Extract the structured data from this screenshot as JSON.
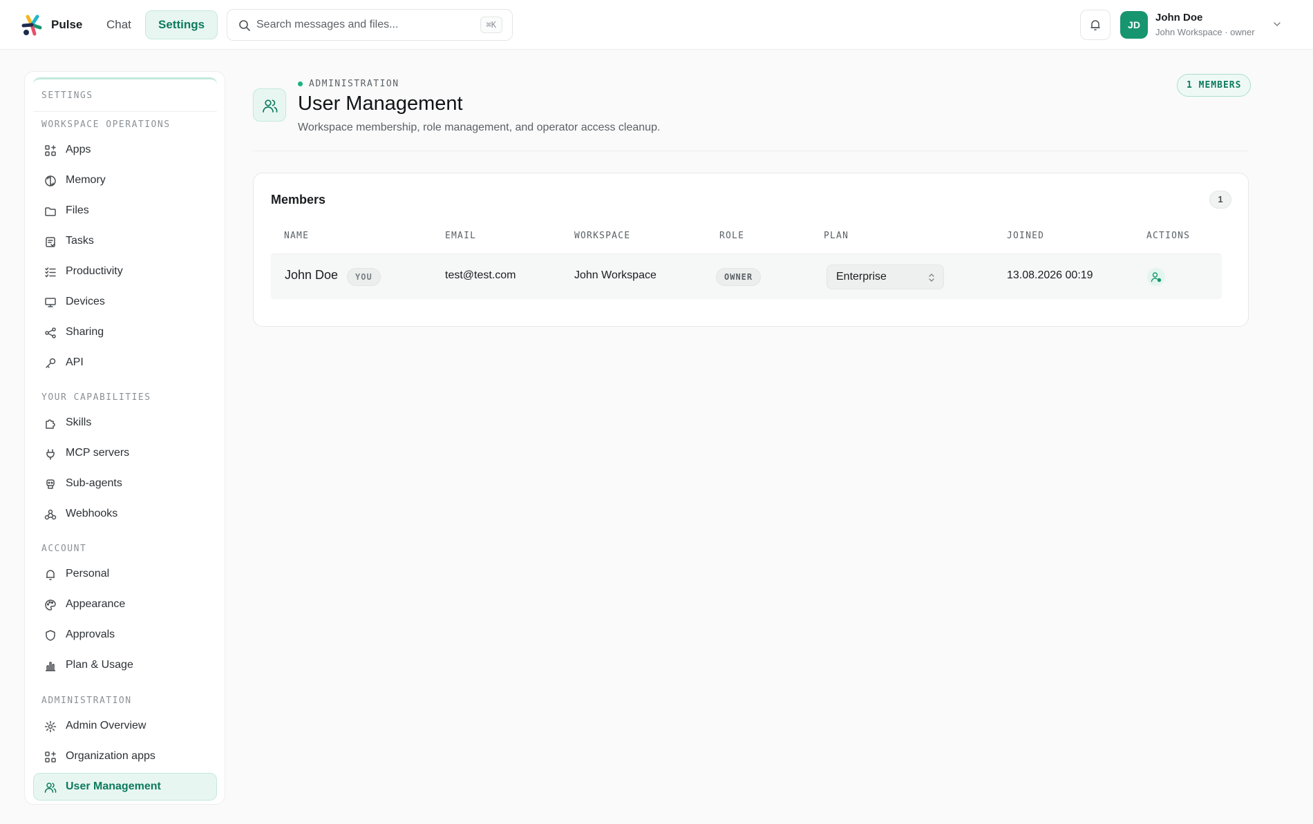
{
  "app": {
    "name": "Pulse"
  },
  "nav": {
    "tabs": [
      "Chat",
      "Settings"
    ],
    "active": "Settings"
  },
  "search": {
    "placeholder": "Search messages and files...",
    "value": "",
    "shortcut": "⌘K"
  },
  "user": {
    "initials": "JD",
    "name": "John Doe",
    "subtitle": "John Workspace · owner"
  },
  "colors": {
    "accent": "#17956f",
    "accent_soft": "#e8f6f1",
    "accent_text": "#0c7a5d"
  },
  "sidebar": {
    "title": "SETTINGS",
    "sections": [
      {
        "heading": "WORKSPACE OPERATIONS",
        "items": [
          {
            "label": "Apps",
            "icon": "grid-plus-icon"
          },
          {
            "label": "Memory",
            "icon": "brain-icon"
          },
          {
            "label": "Files",
            "icon": "folder-icon"
          },
          {
            "label": "Tasks",
            "icon": "clipboard-icon"
          },
          {
            "label": "Productivity",
            "icon": "list-checks-icon"
          },
          {
            "label": "Devices",
            "icon": "monitor-icon"
          },
          {
            "label": "Sharing",
            "icon": "share-icon"
          },
          {
            "label": "API",
            "icon": "key-icon"
          }
        ]
      },
      {
        "heading": "YOUR CAPABILITIES",
        "items": [
          {
            "label": "Skills",
            "icon": "puzzle-icon"
          },
          {
            "label": "MCP servers",
            "icon": "plug-icon"
          },
          {
            "label": "Sub-agents",
            "icon": "bot-icon"
          },
          {
            "label": "Webhooks",
            "icon": "webhook-icon"
          }
        ]
      },
      {
        "heading": "ACCOUNT",
        "items": [
          {
            "label": "Personal",
            "icon": "bell-icon"
          },
          {
            "label": "Appearance",
            "icon": "palette-icon"
          },
          {
            "label": "Approvals",
            "icon": "shield-icon"
          },
          {
            "label": "Plan & Usage",
            "icon": "bar-chart-icon"
          }
        ]
      },
      {
        "heading": "ADMINISTRATION",
        "items": [
          {
            "label": "Admin Overview",
            "icon": "gear-icon"
          },
          {
            "label": "Organization apps",
            "icon": "grid-plus-icon"
          },
          {
            "label": "User Management",
            "icon": "users-icon",
            "active": true
          }
        ]
      }
    ]
  },
  "page": {
    "eyebrow": "ADMINISTRATION",
    "title": "User Management",
    "subtitle": "Workspace membership, role management, and operator access cleanup.",
    "member_badge": "1 MEMBERS"
  },
  "members": {
    "title": "Members",
    "count": "1",
    "columns": [
      "NAME",
      "EMAIL",
      "WORKSPACE",
      "ROLE",
      "PLAN",
      "JOINED",
      "ACTIONS"
    ],
    "rows": [
      {
        "name": "John Doe",
        "you_badge": "YOU",
        "email": "test@test.com",
        "workspace": "John Workspace",
        "role": "OWNER",
        "plan": "Enterprise",
        "joined": "13.08.2026 00:19",
        "action_icon": "user-cog-icon"
      }
    ]
  }
}
